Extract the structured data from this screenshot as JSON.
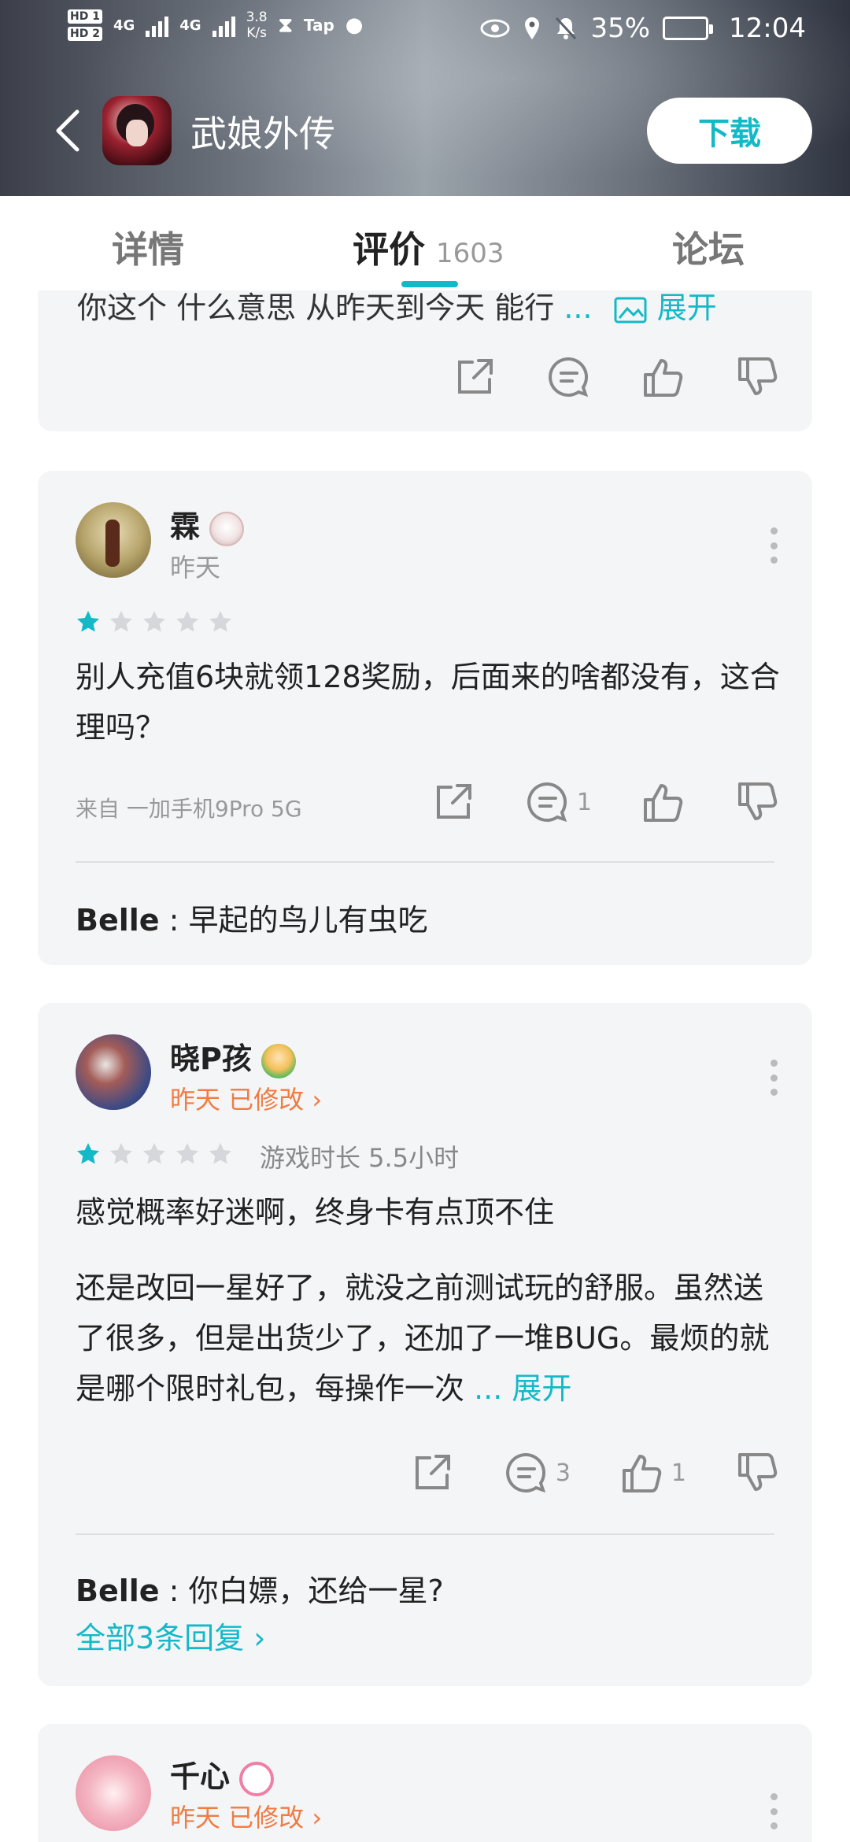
{
  "status_bar": {
    "sim1": "HD 1",
    "sim2": "HD 2",
    "net1": "4G",
    "net2": "4G",
    "speed_value": "3.8",
    "speed_unit": "K/s",
    "tap_label": "Tap",
    "battery": "35%",
    "time": "12:04"
  },
  "app_bar": {
    "title": "武娘外传",
    "download_label": "下载"
  },
  "tabs": [
    {
      "label": "详情"
    },
    {
      "label": "评价",
      "count": "1603"
    },
    {
      "label": "论坛"
    }
  ],
  "reviews": [
    {
      "partial_text": "你这个 什么意思 从昨天到今天 能行",
      "more": "...",
      "expand": "展开"
    },
    {
      "username": "霖",
      "date": "昨天",
      "rating": 1,
      "text": "别人充值6块就领128奖励，后面来的啥都没有，这合理吗？",
      "device": "来自 一加手机9Pro 5G",
      "comment_count": "1",
      "reply_user": "Belle",
      "reply_sep": " : ",
      "reply_text": "早起的鸟儿有虫吃"
    },
    {
      "username": "晓P孩",
      "date": "昨天 已修改 ›",
      "rating": 1,
      "playtime": "游戏时长 5.5小时",
      "text1": "感觉概率好迷啊，终身卡有点顶不住",
      "text2": "还是改回一星好了，就没之前测试玩的舒服。虽然送了很多，但是出货少了，还加了一堆BUG。最烦的就是哪个限时礼包，每操作一次",
      "more": " ... ",
      "expand": "展开",
      "comment_count": "3",
      "like_count": "1",
      "reply_user": "Belle",
      "reply_sep": " : ",
      "reply_text": "你白嫖，还给一星?",
      "all_replies": "全部3条回复 ›"
    },
    {
      "username": "千心",
      "date": "昨天 已修改 ›"
    }
  ],
  "colors": {
    "accent": "#14b9c8",
    "orange": "#f07c42",
    "card_bg": "#f4f5f7"
  }
}
